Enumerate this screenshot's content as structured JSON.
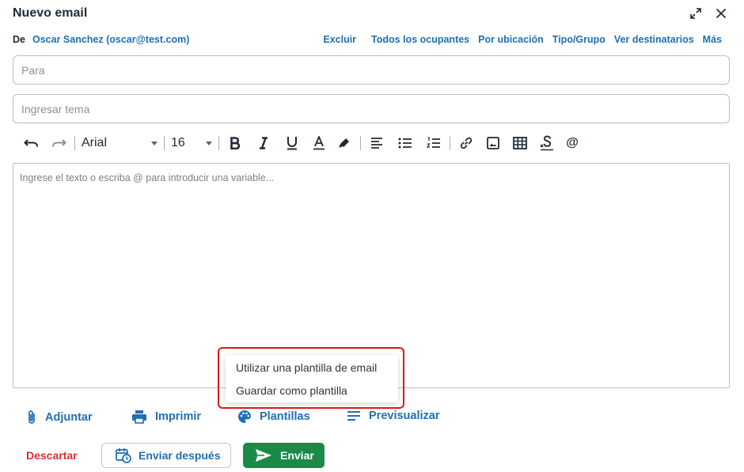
{
  "window": {
    "title": "Nuevo email"
  },
  "from": {
    "label": "De",
    "value": "Oscar Sanchez (oscar@test.com)",
    "links": [
      "Excluir",
      "Todos los ocupantes",
      "Por ubicación",
      "Tipo/Grupo",
      "Ver destinatarios",
      "Más"
    ]
  },
  "fields": {
    "to_placeholder": "Para",
    "to_value": "",
    "subject_placeholder": "Ingresar tema",
    "subject_value": ""
  },
  "toolbar": {
    "font": "Arial",
    "size": "16",
    "mention": "@"
  },
  "editor": {
    "placeholder": "Ingrese el texto o escriba @ para introducir una variable..."
  },
  "templates_menu": {
    "items": [
      "Utilizar una plantilla de email",
      "Guardar como plantilla"
    ]
  },
  "actions": {
    "attach": "Adjuntar",
    "print": "Imprimir",
    "templates": "Plantillas",
    "preview": "Previsualizar"
  },
  "footer": {
    "discard": "Descartar",
    "send_later": "Enviar después",
    "send": "Enviar"
  },
  "colors": {
    "link": "#1f6fb3",
    "send_button": "#1c8a47",
    "discard": "#d6312c",
    "highlight": "#d9191a"
  }
}
